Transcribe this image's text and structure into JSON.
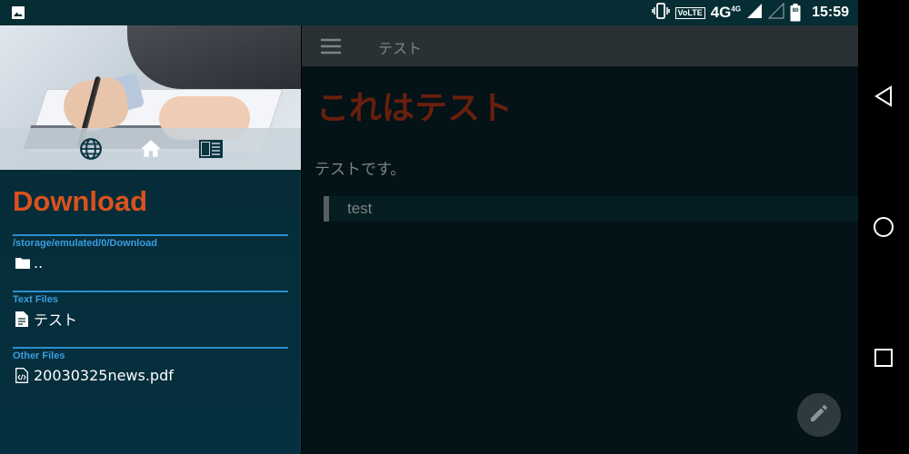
{
  "status_bar": {
    "time": "15:59",
    "volte_label": "VoLTE",
    "network_label": "4G",
    "network_sup": "4G",
    "battery_level": "80",
    "icons": [
      "image-icon",
      "vibrate-icon",
      "signal-icon",
      "battery-icon"
    ]
  },
  "drawer": {
    "title": "Download",
    "header_icons": [
      "globe-icon",
      "home-icon",
      "reader-icon"
    ],
    "sections": [
      {
        "label": "/storage/emulated/0/Download",
        "items": [
          {
            "name": "..",
            "icon": "folder-icon"
          }
        ]
      },
      {
        "label": "Text Files",
        "items": [
          {
            "name": "テスト",
            "icon": "document-icon"
          }
        ]
      },
      {
        "label": "Other Files",
        "items": [
          {
            "name": "20030325news.pdf",
            "icon": "code-file-icon"
          }
        ]
      }
    ]
  },
  "main": {
    "toolbar_title": "テスト",
    "heading": "これはテスト",
    "paragraph": "テストです。",
    "blockquote": "test"
  },
  "nav": {
    "icons": [
      "back-icon",
      "home-circle-icon",
      "recents-icon"
    ]
  },
  "colors": {
    "accent": "#d8531e",
    "section_line": "#2a8fd0",
    "section_label": "#3a9ee0",
    "drawer_bg": "#062a35",
    "main_bg": "#031318"
  }
}
